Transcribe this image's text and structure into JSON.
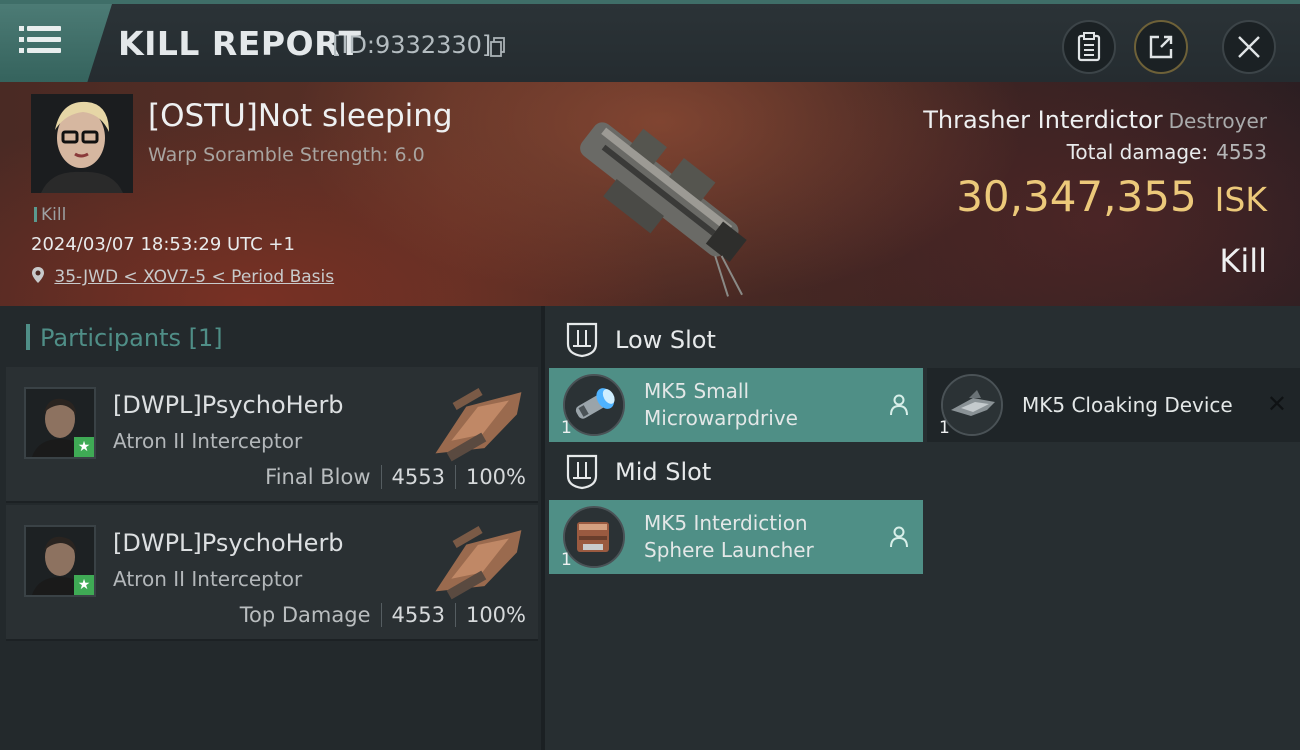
{
  "header": {
    "title": "KILL REPORT",
    "report_id": "[ID:9332330]",
    "icons": [
      "menu-icon",
      "copy-icon",
      "clipboard-icon",
      "share-icon",
      "close-icon"
    ]
  },
  "victim": {
    "name": "[OSTU]Not sleeping",
    "scramble": "Warp Soramble Strength: 6.0",
    "kill_tag": "Kill",
    "datetime": "2024/03/07 18:53:29 UTC +1",
    "location": "35-JWD < XOV7-5 < Period Basis",
    "ship_name": "Thrasher Interdictor",
    "ship_class": "Destroyer",
    "total_damage_label": "Total damage:",
    "total_damage": "4553",
    "isk_value": "30,347,355",
    "isk_unit": "ISK",
    "result": "Kill"
  },
  "participants": {
    "label": "Participants",
    "count": "[1]",
    "items": [
      {
        "name": "[DWPL]PsychoHerb",
        "ship": "Atron II Interceptor",
        "role": "Final Blow",
        "damage": "4553",
        "percent": "100%"
      },
      {
        "name": "[DWPL]PsychoHerb",
        "ship": "Atron II Interceptor",
        "role": "Top Damage",
        "damage": "4553",
        "percent": "100%"
      }
    ]
  },
  "slots": {
    "low": {
      "label": "Low Slot",
      "modules": [
        {
          "qty": "1",
          "line1": "MK5 Small",
          "line2": "Microwarpdrive",
          "state": "fitted"
        },
        {
          "qty": "1",
          "line1": "MK5 Cloaking Device",
          "line2": "",
          "state": "dropped"
        }
      ]
    },
    "mid": {
      "label": "Mid Slot",
      "modules": [
        {
          "qty": "1",
          "line1": "MK5 Interdiction",
          "line2": "Sphere Launcher",
          "state": "fitted"
        }
      ]
    }
  },
  "colors": {
    "accent": "#4f8f86",
    "isk": "#ecc97a",
    "panel": "#23292c"
  }
}
